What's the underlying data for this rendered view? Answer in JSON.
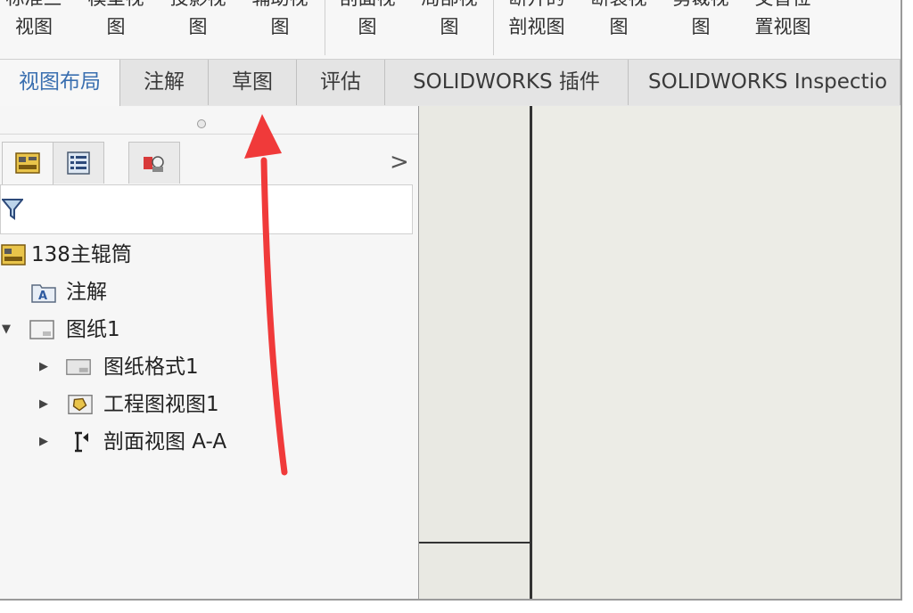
{
  "ribbon": {
    "buttons": [
      {
        "line1": "标准三",
        "line2": "视图"
      },
      {
        "line1": "模型视",
        "line2": "图"
      },
      {
        "line1": "投影视",
        "line2": "图"
      },
      {
        "line1": "辅助视",
        "line2": "图"
      },
      {
        "line1": "剖面视",
        "line2": "图"
      },
      {
        "line1": "局部视",
        "line2": "图"
      },
      {
        "line1": "断开的",
        "line2": "剖视图"
      },
      {
        "line1": "断裂视",
        "line2": "图"
      },
      {
        "line1": "剪裁视",
        "line2": "图"
      },
      {
        "line1": "交替位",
        "line2": "置视图"
      }
    ]
  },
  "tabs": [
    "视图布局",
    "注解",
    "草图",
    "评估",
    "SOLIDWORKS 插件",
    "SOLIDWORKS Inspectio"
  ],
  "active_tab": "视图布局",
  "panel": {
    "tabs": [
      "feature-manager",
      "property-manager",
      "display-manager"
    ],
    "chevron": ">",
    "tree": {
      "root": "138主辊筒",
      "annotations": "注解",
      "sheet": "图纸1",
      "sheet_format": "图纸格式1",
      "drawing_view": "工程图视图1",
      "section_view": "剖面视图 A-A"
    }
  },
  "colors": {
    "annotation_arrow": "#f03a3a",
    "active_tab_text": "#3a6fb0"
  }
}
